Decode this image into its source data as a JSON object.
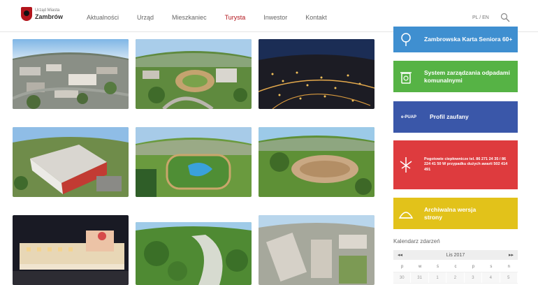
{
  "header": {
    "logo_small": "Urząd Miasta",
    "logo_big": "Zambrów",
    "nav": [
      "Aktualności",
      "Urząd",
      "Mieszkaniec",
      "Turysta",
      "Inwestor",
      "Kontakt"
    ],
    "active_nav": "Turysta",
    "lang": "PL / EN",
    "search_icon": "search-icon"
  },
  "gallery": {
    "photos": [
      "aerial-city-day-1",
      "aerial-stadium-park",
      "aerial-city-night",
      "aerial-school-building",
      "aerial-sports-field",
      "aerial-track-field",
      "aerial-building-night",
      "aerial-green-park",
      "aerial-housing-estate"
    ]
  },
  "sidebar": {
    "buttons": [
      {
        "label": "Zambrowska Karta Seniora 60+",
        "icon": "tree-icon",
        "color": "#3f8fd0"
      },
      {
        "label": "System zarządzania odpadami komunalnymi",
        "icon": "recycle-bin-icon",
        "color": "#56b345"
      },
      {
        "label": "Profil zaufany",
        "icon": "epuap-icon",
        "logo_text": "e-PUAP",
        "color": "#3a57a9"
      },
      {
        "label": "Pogotowie ciepłownicze tel. 86 271 24 35 / 86 224 41 50 W przypadku dużych awarii 502 414 491",
        "icon": "radiator-icon",
        "color": "#de3b3e"
      },
      {
        "label": "Archiwalna wersja strony",
        "icon": "archive-icon",
        "color": "#e2c21a"
      }
    ]
  },
  "calendar": {
    "title": "Kalendarz zdarzeń",
    "month": "Lis 2017",
    "prev": "◂◂",
    "next": "▸▸",
    "weekdays": [
      "p",
      "w",
      "ś",
      "c",
      "p",
      "s",
      "n"
    ],
    "week1": [
      "30",
      "31",
      "1",
      "2",
      "3",
      "4",
      "5"
    ]
  }
}
